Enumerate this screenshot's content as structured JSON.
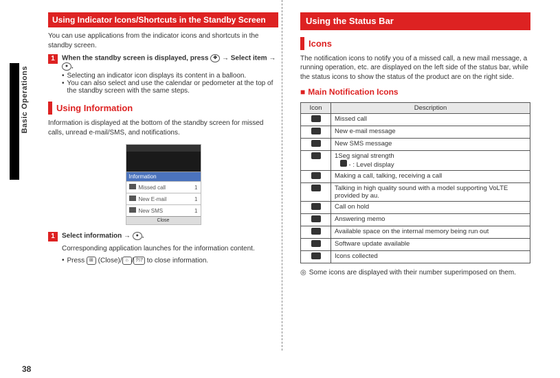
{
  "page_number": "38",
  "side_label": "Basic Operations",
  "left": {
    "heading1": "Using Indicator Icons/Shortcuts in the Standby Screen",
    "intro1": "You can use applications from the indicator icons and shortcuts in the standby screen.",
    "step1_num": "1",
    "step1_textA": "When the standby screen is displayed, press ",
    "step1_textB": " → Select item → ",
    "step1_textC": ".",
    "step1_b1": "Selecting an indicator icon displays its content in a balloon.",
    "step1_b2": "You can also select and use the calendar or pedometer at the top of the standby screen with the same steps.",
    "heading2": "Using Information",
    "intro2": "Information is displayed at the bottom of the standby screen for missed calls, unread e-mail/SMS, and notifications.",
    "mock_info": "Information",
    "mock_missed": "Missed call",
    "mock_email": "New E-mail",
    "mock_sms": "New SMS",
    "mock_close": "Close",
    "mock_count": "1",
    "step2_num": "1",
    "step2_textA": "Select information → ",
    "step2_textB": ".",
    "step2_sub": "Corresponding application launches for the information content.",
    "step2_bA": "Press ",
    "step2_bB": " (Close)/",
    "step2_bC": "/",
    "step2_bD": " to close information."
  },
  "right": {
    "heading1": "Using the Status Bar",
    "sub1": "Icons",
    "intro1": "The notification icons to notify you of a missed call, a new mail message, a running operation, etc. are displayed on the left side of the status bar, while the status icons to show the status of the product are on the right side.",
    "sub2": "Main Notification Icons",
    "th_icon": "Icon",
    "th_desc": "Description",
    "rows": [
      "Missed call",
      "New e-mail message",
      "New SMS message",
      "1Seg signal strength",
      "Making a call, talking, receiving a call",
      "Talking in high quality sound with a model supporting VoLTE provided by au.",
      "Call on hold",
      "Answering memo",
      "Available space on the internal memory being run out",
      "Software update available",
      "Icons collected"
    ],
    "row3_sub": " -  : Level display",
    "note_sym": "◎",
    "note": "Some icons are displayed with their number superimposed on them."
  }
}
